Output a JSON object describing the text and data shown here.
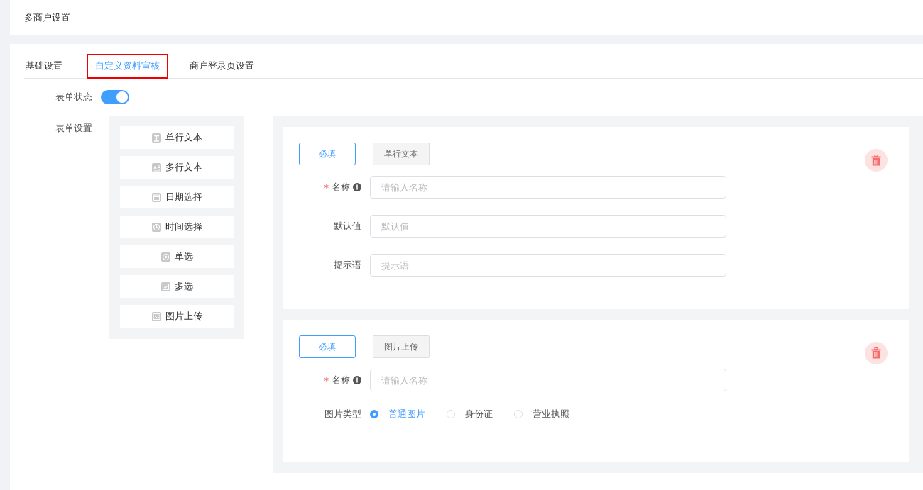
{
  "header": {
    "title": "多商户设置"
  },
  "tabs": [
    {
      "label": "基础设置",
      "selected": false,
      "highlighted": false
    },
    {
      "label": "自定义资料审核",
      "selected": true,
      "highlighted": true
    },
    {
      "label": "商户登录页设置",
      "selected": false,
      "highlighted": false
    }
  ],
  "form_status": {
    "label": "表单状态",
    "on": true
  },
  "form_settings": {
    "label": "表单设置"
  },
  "palette": [
    {
      "kind": "text",
      "label": "单行文本"
    },
    {
      "kind": "textarea",
      "label": "多行文本"
    },
    {
      "kind": "date",
      "label": "日期选择"
    },
    {
      "kind": "time",
      "label": "时间选择"
    },
    {
      "kind": "radio",
      "label": "单选"
    },
    {
      "kind": "checkbox",
      "label": "多选"
    },
    {
      "kind": "image",
      "label": "图片上传"
    }
  ],
  "cards": [
    {
      "kind": "text",
      "required_button": "必填",
      "type_tag": "单行文本",
      "fields": [
        {
          "label": "名称",
          "required_mark": "*",
          "info": true,
          "placeholder": "请输入名称"
        },
        {
          "label": "默认值",
          "info": false,
          "placeholder": "默认值"
        },
        {
          "label": "提示语",
          "info": false,
          "placeholder": "提示语"
        }
      ]
    },
    {
      "kind": "image",
      "required_button": "必填",
      "type_tag": "图片上传",
      "fields": [
        {
          "label": "名称",
          "required_mark": "*",
          "info": true,
          "placeholder": "请输入名称"
        }
      ],
      "radio_label": "图片类型",
      "options": [
        {
          "label": "普通图片",
          "selected": true
        },
        {
          "label": "身份证",
          "selected": false
        },
        {
          "label": "营业执照",
          "selected": false
        }
      ]
    }
  ]
}
